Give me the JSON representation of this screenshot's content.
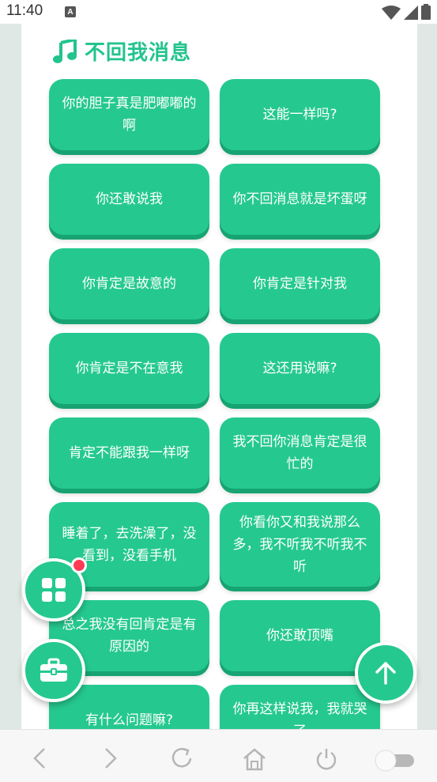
{
  "status_bar": {
    "time": "11:40",
    "a_icon_label": "A"
  },
  "section": {
    "title": "不回我消息",
    "icon": "music-note-icon",
    "accent_color": "#22c38e"
  },
  "phrases": [
    "你的胆子真是肥嘟嘟的啊",
    "这能一样吗?",
    "你还敢说我",
    "你不回消息就是坏蛋呀",
    "你肯定是故意的",
    "你肯定是针对我",
    "你肯定是不在意我",
    "这还用说嘛?",
    "肯定不能跟我一样呀",
    "我不回你消息肯定是很忙的",
    "睡着了，去洗澡了，没看到，没看手机",
    "你看你又和我说那么多，我不听我不听我不听",
    "总之我没有回肯定是有原因的",
    "你还敢顶嘴",
    "有什么问题嘛?",
    "你再这样说我，我就哭了"
  ],
  "fabs": {
    "grid": "grid-icon",
    "toolbox": "toolbox-icon",
    "scroll_top": "arrow-up-icon"
  },
  "bottom_nav": [
    "back-icon",
    "forward-icon",
    "refresh-icon",
    "home-icon",
    "power-icon",
    "toggle-switch"
  ]
}
